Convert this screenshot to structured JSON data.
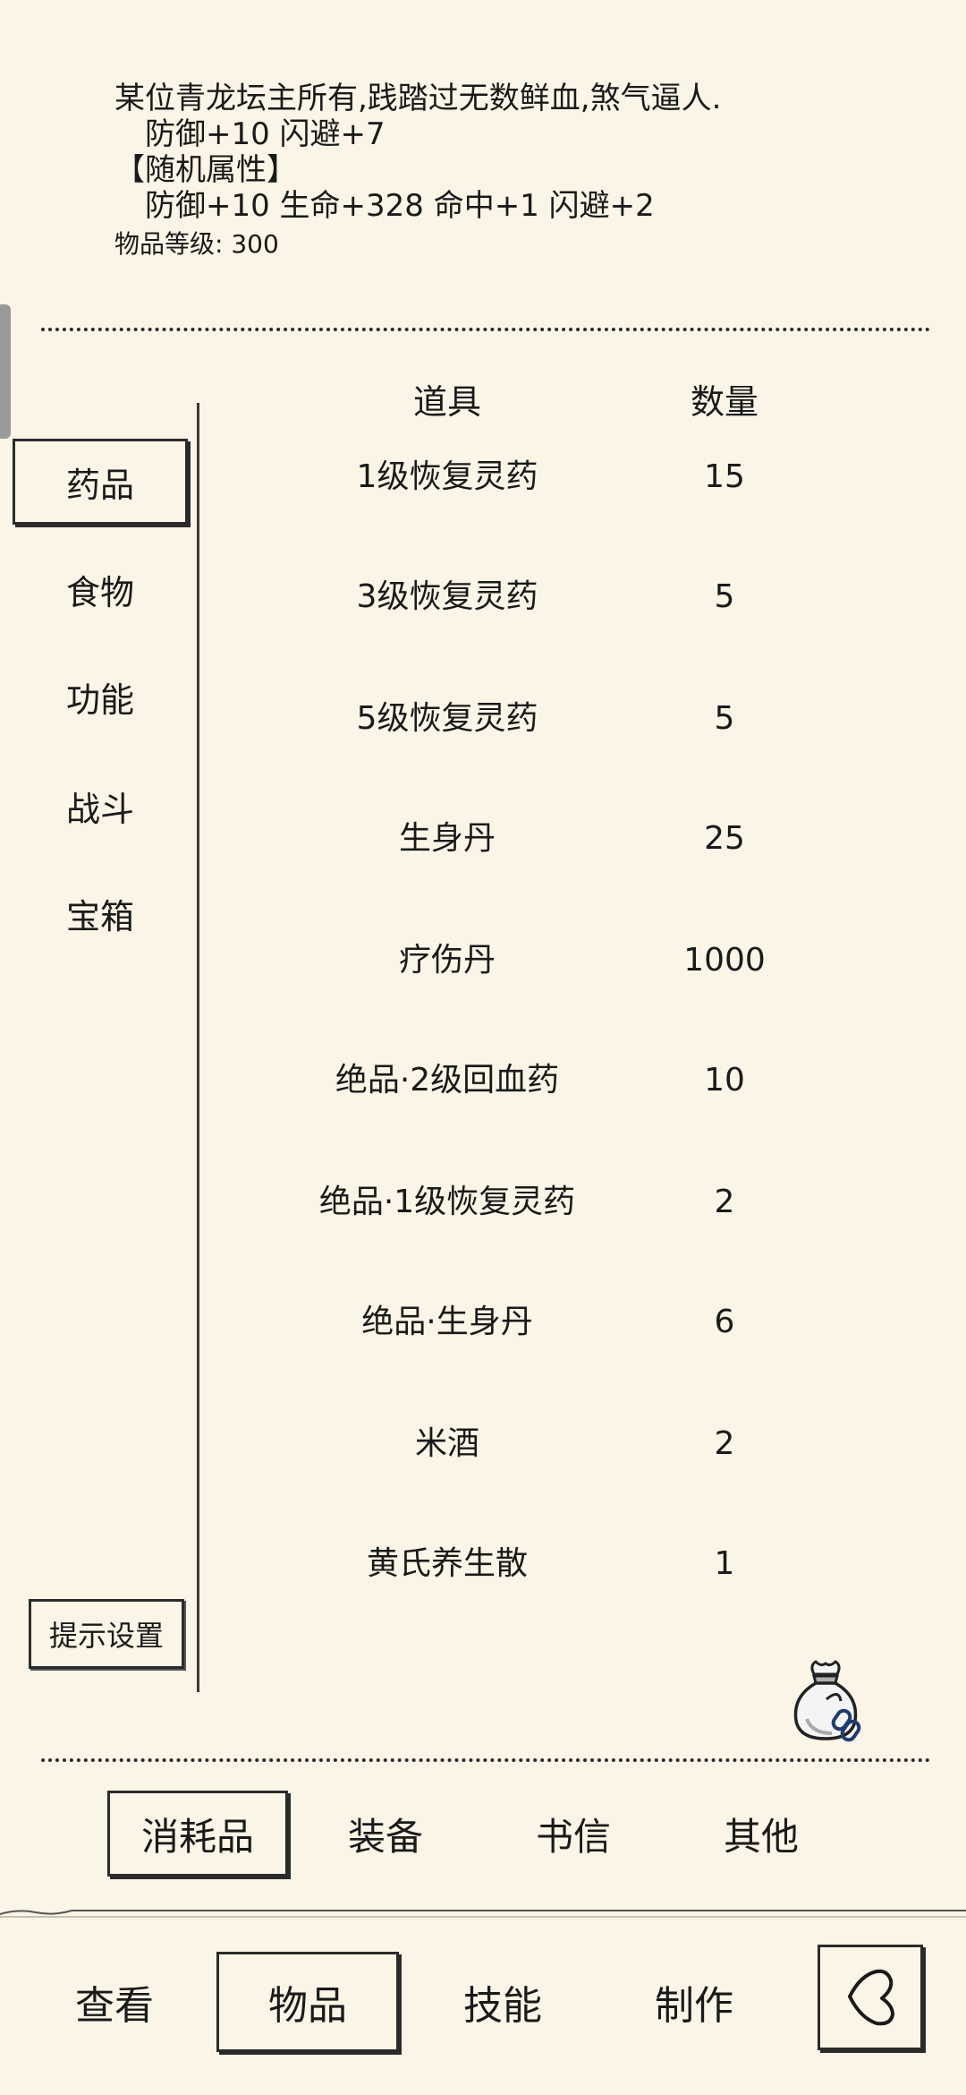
{
  "item_detail": {
    "description": "某位青龙坛主所有,践踏过无数鲜血,煞气逼人.",
    "base_stats": "防御+10 闪避+7",
    "random_header": "【随机属性】",
    "random_stats": "防御+10 生命+328 命中+1 闪避+2",
    "item_level": "物品等级: 300"
  },
  "sidebar": {
    "categories": [
      {
        "label": "药品",
        "selected": true
      },
      {
        "label": "食物",
        "selected": false
      },
      {
        "label": "功能",
        "selected": false
      },
      {
        "label": "战斗",
        "selected": false
      },
      {
        "label": "宝箱",
        "selected": false
      }
    ],
    "tip_settings_label": "提示设置"
  },
  "table": {
    "headers": {
      "name": "道具",
      "quantity": "数量"
    },
    "rows": [
      {
        "name": "1级恢复灵药",
        "quantity": "15"
      },
      {
        "name": "3级恢复灵药",
        "quantity": "5"
      },
      {
        "name": "5级恢复灵药",
        "quantity": "5"
      },
      {
        "name": "生身丹",
        "quantity": "25"
      },
      {
        "name": "疗伤丹",
        "quantity": "1000"
      },
      {
        "name": "绝品·2级回血药",
        "quantity": "10"
      },
      {
        "name": "绝品·1级恢复灵药",
        "quantity": "2"
      },
      {
        "name": "绝品·生身丹",
        "quantity": "6"
      },
      {
        "name": "米酒",
        "quantity": "2"
      },
      {
        "name": "黄氏养生散",
        "quantity": "1"
      }
    ]
  },
  "subtabs": [
    {
      "label": "消耗品",
      "selected": true
    },
    {
      "label": "装备",
      "selected": false
    },
    {
      "label": "书信",
      "selected": false
    },
    {
      "label": "其他",
      "selected": false
    }
  ],
  "bottom_nav": [
    {
      "label": "查看",
      "selected": false
    },
    {
      "label": "物品",
      "selected": true
    },
    {
      "label": "技能",
      "selected": false
    },
    {
      "label": "制作",
      "selected": false
    }
  ],
  "icons": {
    "bag": "loot-bag-icon",
    "back": "back-arrow-icon"
  },
  "colors": {
    "background": "#faf5e6",
    "ink": "#1a1a1a"
  }
}
